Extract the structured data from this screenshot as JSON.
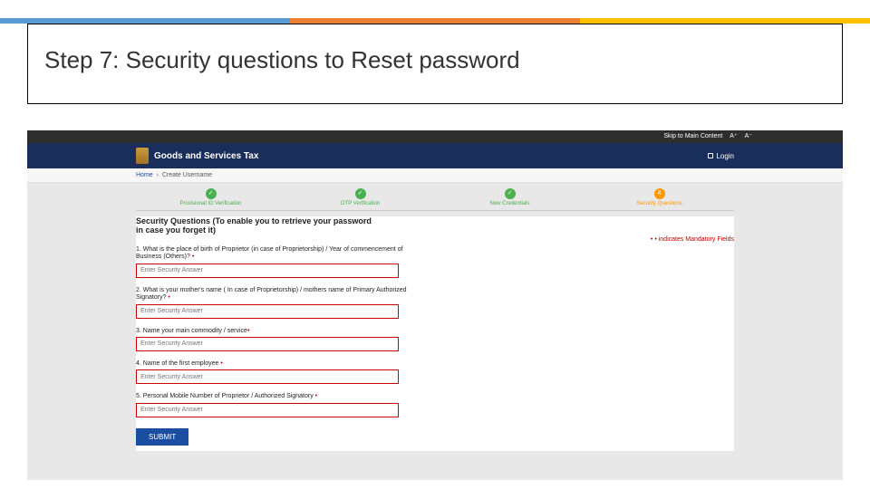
{
  "slide": {
    "title": "Step 7: Security questions to Reset password"
  },
  "utilbar": {
    "skip": "Skip to Main Content",
    "aplus": "A⁺",
    "aminus": "A⁻"
  },
  "header": {
    "brand": "Goods and Services Tax",
    "login": "Login"
  },
  "crumb": {
    "home": "Home",
    "current": "Create Username"
  },
  "steps": {
    "s1": "Provisional ID Verification",
    "s2": "OTP Verification",
    "s3": "New Credentials",
    "s4": "Security Questions",
    "s4num": "4"
  },
  "form": {
    "heading": "Security Questions (To enable you to retrieve your password in case you forget it)",
    "mandatory": "• indicates Mandatory Fields",
    "star": "•",
    "q1": "1. What is the place of birth of Proprietor (in case of Proprietorship) / Year of commencement of Business (Others)?",
    "q2": "2. What is your mother's name ( In case of Proprietorship) / mothers name of Primary Authorized Signatory?",
    "q3": "3. Name your main commodity / service",
    "q4": "4. Name of the first employee",
    "q5": "5. Personal Mobile Number of Proprietor / Authorized Signatory",
    "placeholder": "Enter Security Answer",
    "submit": "SUBMIT"
  }
}
